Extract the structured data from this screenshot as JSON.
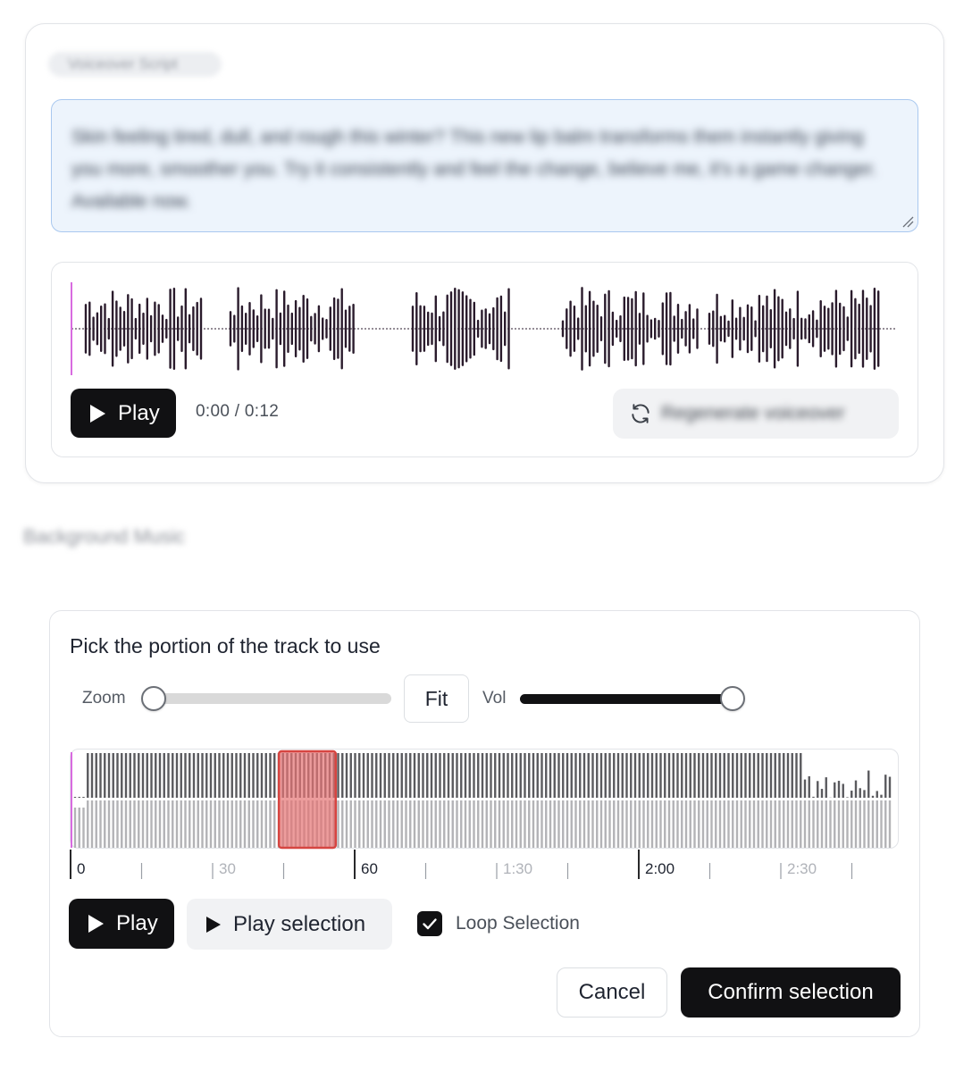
{
  "voiceover": {
    "label": "Voiceover Script",
    "script": "Skin feeling tired, dull, and rough this winter? This new lip balm transforms them instantly giving you more, smoother you. Try it consistently and feel the change, believe me, it's a game changer. Available now.",
    "play_label": "Play",
    "time": "0:00 / 0:12",
    "regenerate_label": "Regenerate voiceover",
    "regenerate_icon": "refresh-icon"
  },
  "background_music": {
    "label": "Background Music"
  },
  "track_picker": {
    "title": "Pick the portion of the track to use",
    "zoom_label": "Zoom",
    "zoom_level": 0,
    "fit_label": "Fit",
    "vol_label": "Vol",
    "volume_level": 1.0,
    "timeline_labels": [
      "0",
      "30",
      "60",
      "1:30",
      "2:00",
      "2:30"
    ],
    "selection_start_seconds": 44,
    "selection_end_seconds": 56,
    "play_label": "Play",
    "play_selection_label": "Play selection",
    "loop_label": "Loop Selection",
    "loop_checked": true,
    "cancel_label": "Cancel",
    "confirm_label": "Confirm selection"
  },
  "colors": {
    "primary": "#111113",
    "selection_fill": "#e57373",
    "selection_border": "#d64541",
    "playhead": "#d86be0",
    "script_bg": "#edf4fc"
  }
}
